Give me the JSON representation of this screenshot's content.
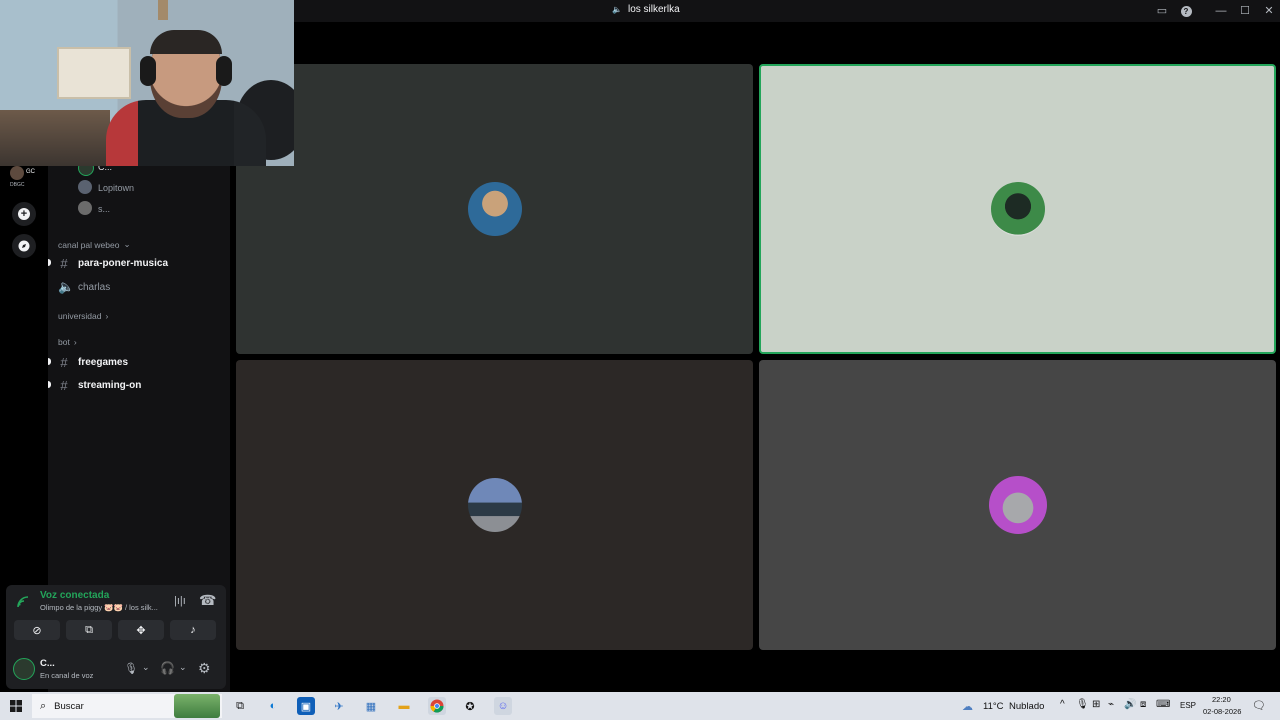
{
  "window": {
    "title": "los silkerlka",
    "controls": [
      "▭",
      "?",
      "—",
      "☐",
      "✕"
    ]
  },
  "server_rail": {
    "server_abbrev": "GC",
    "server_sub": "DBGC",
    "add_icon": "+",
    "discover_icon": "compass"
  },
  "channels": {
    "voice_members": [
      {
        "name": "C..."
      },
      {
        "name": "Lopitown"
      },
      {
        "name": "s..."
      }
    ],
    "categories": [
      {
        "label": "canal pal webeo",
        "chevron": "⌄",
        "items": [
          {
            "type": "text",
            "name": "para-poner-musica",
            "unread": true
          },
          {
            "type": "voice",
            "name": "charlas",
            "unread": false
          }
        ]
      },
      {
        "label": "universidad",
        "chevron": "›",
        "items": []
      },
      {
        "label": "bot",
        "chevron": "›",
        "items": [
          {
            "type": "text",
            "name": "freegames",
            "unread": true
          },
          {
            "type": "text",
            "name": "streaming-on",
            "unread": true
          }
        ]
      }
    ]
  },
  "voice_panel": {
    "status": "Voz conectada",
    "location": "Olimpo de la piggy 🐷🐷 / los silk...",
    "status_color": "#23a55a",
    "buttons": [
      "camera-off-icon",
      "screen-share-icon",
      "activities-icon",
      "soundboard-icon"
    ]
  },
  "user_panel": {
    "name": "C...",
    "substatus": "En canal de voz"
  },
  "stage": {
    "tiles": [
      {
        "id": "p1",
        "bg": "#2f3331",
        "speaking": false
      },
      {
        "id": "p2",
        "bg": "#c9d2c8",
        "speaking": true
      },
      {
        "id": "p3",
        "bg": "#2c2826",
        "speaking": false
      },
      {
        "id": "p4",
        "bg": "#464646",
        "speaking": false
      }
    ],
    "speaking_color": "#23a55a"
  },
  "taskbar": {
    "search_placeholder": "Buscar",
    "weather_temp": "11°C",
    "weather_text": "Nublado",
    "lang": "ESP",
    "time": "22:20",
    "date": "02-08-2026"
  }
}
